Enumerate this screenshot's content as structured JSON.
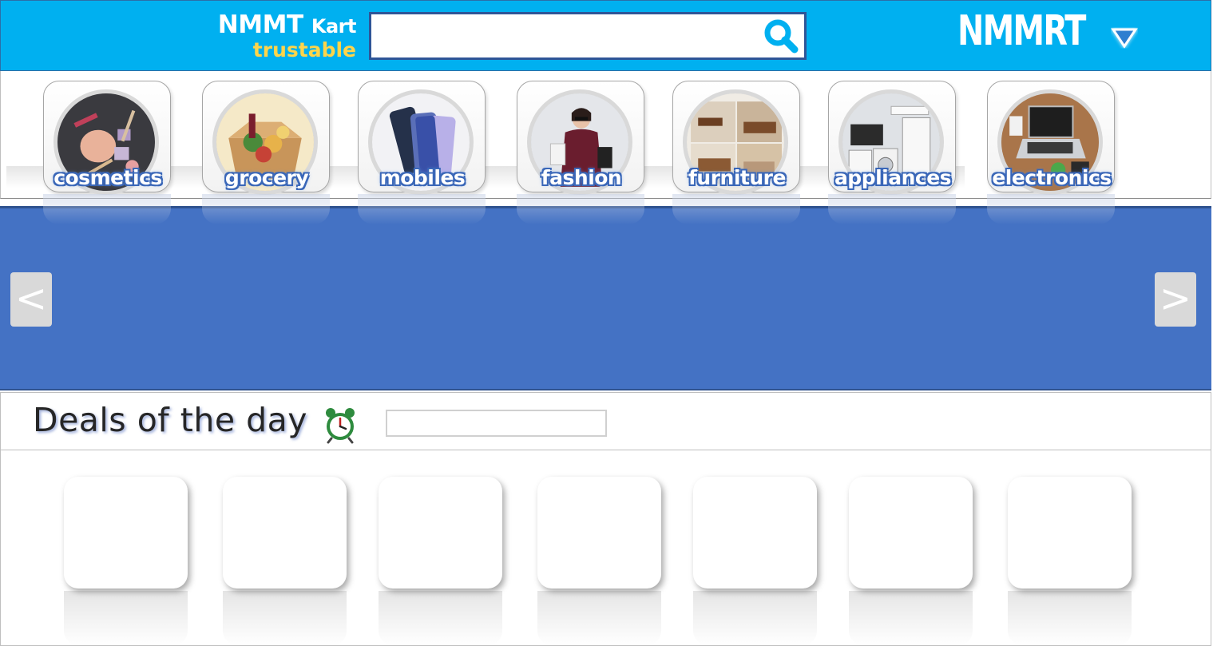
{
  "header": {
    "brand_name": "NMMT",
    "brand_suffix": "Kart",
    "brand_tagline": "trustable",
    "search": {
      "value": "",
      "placeholder": "",
      "icon": "search-icon"
    },
    "logo_text": "NMMRT",
    "menu_icon": "triangle-down-icon"
  },
  "categories": [
    {
      "label": "cosmetics"
    },
    {
      "label": "grocery"
    },
    {
      "label": "mobiles"
    },
    {
      "label": "fashion"
    },
    {
      "label": "furniture"
    },
    {
      "label": "appliances"
    },
    {
      "label": "electronics"
    }
  ],
  "banner": {
    "prev_label": "<",
    "next_label": ">"
  },
  "deals": {
    "title": "Deals of the day",
    "icon": "alarm-clock-icon",
    "timer_value": ""
  },
  "colors": {
    "header_bg": "#00b0f0",
    "banner_bg": "#4472c4",
    "tagline": "#ffd54a",
    "category_label_outline": "#3a67b8"
  }
}
